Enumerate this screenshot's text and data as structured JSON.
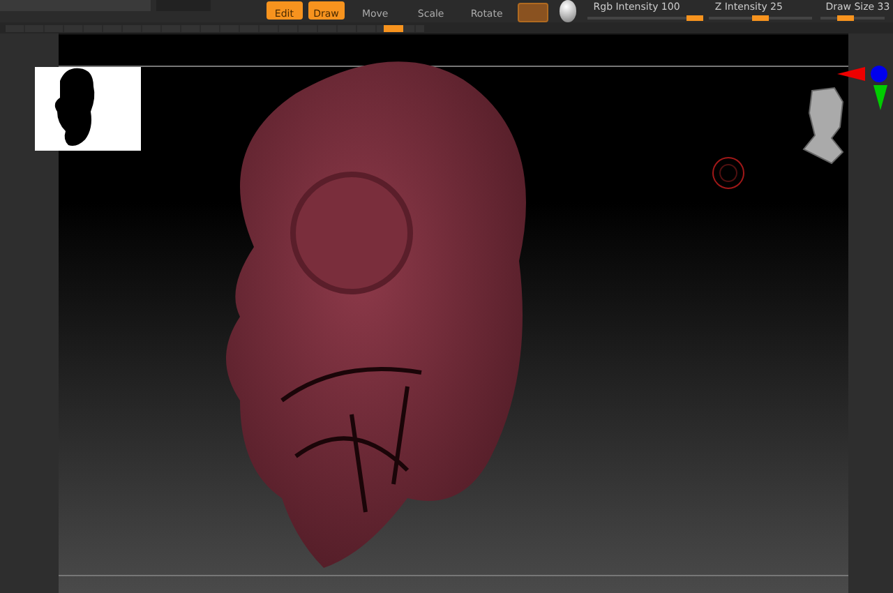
{
  "toolbar": {
    "buttons": [
      {
        "label": "Edit",
        "selected": true
      },
      {
        "label": "Draw",
        "selected": true
      },
      {
        "label": "Move",
        "selected": false
      },
      {
        "label": "Scale",
        "selected": false
      },
      {
        "label": "Rotate",
        "selected": false
      }
    ],
    "sliders": [
      {
        "label": "Rgb Intensity 100",
        "level": 0.95
      },
      {
        "label": "Z Intensity 25",
        "level": 0.5
      },
      {
        "label": "Draw Size 33",
        "level": 0.4
      }
    ]
  },
  "progress": {
    "level": 0.95
  }
}
